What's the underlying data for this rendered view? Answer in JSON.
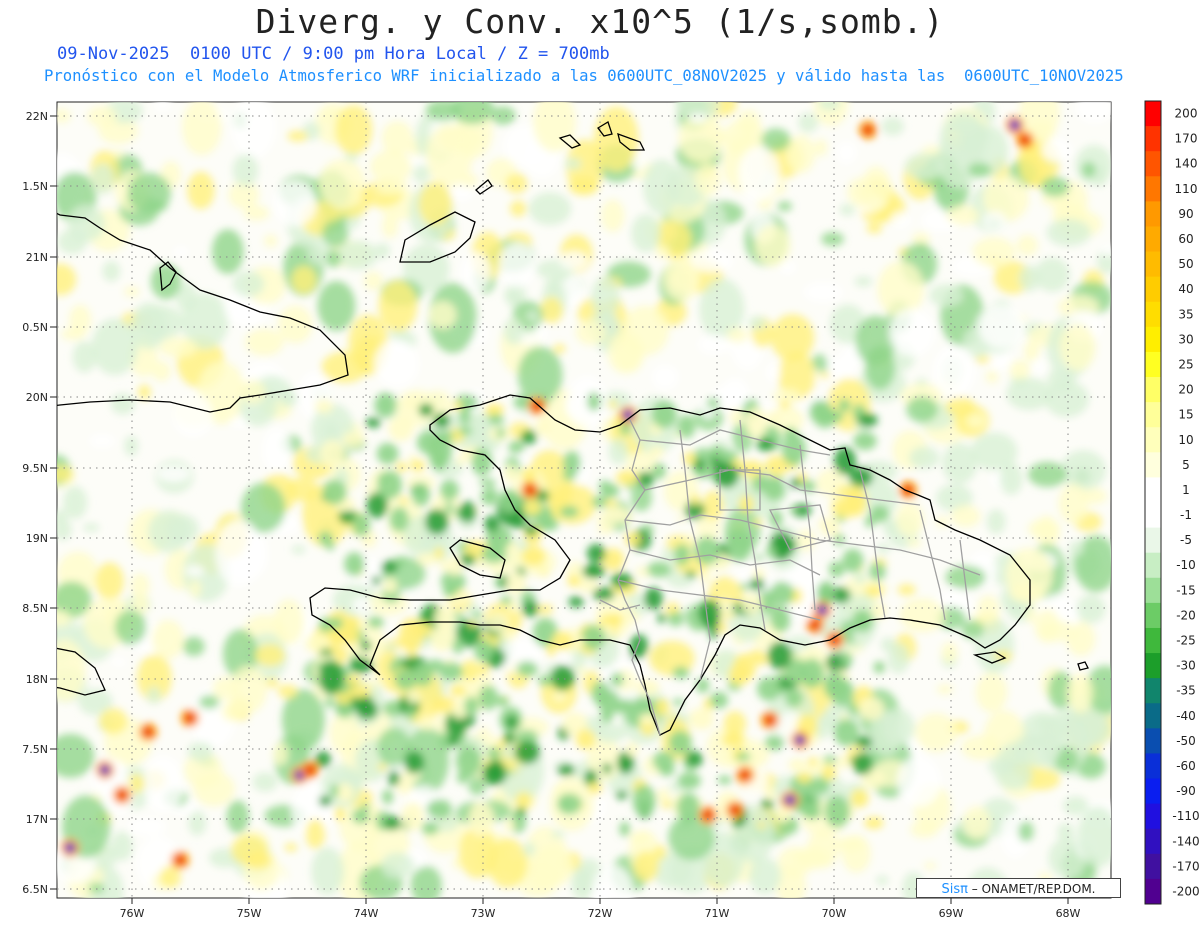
{
  "header": {
    "title": "Diverg. y Conv. x10^5 (1/s,somb.)",
    "subtitle_line1": "09-Nov-2025  0100 UTC / 9:00 pm Hora Local / Z = 700mb",
    "subtitle_line2": "Pronóstico con el Modelo Atmosferico WRF inicializado a las 0600UTC_08NOV2025 y válido hasta las  0600UTC_10NOV2025"
  },
  "map": {
    "lat_labels": [
      "22N",
      "1.5N",
      "21N",
      "0.5N",
      "20N",
      "9.5N",
      "19N",
      "8.5N",
      "18N",
      "7.5N",
      "17N",
      "6.5N"
    ],
    "lon_labels": [
      "76W",
      "75W",
      "74W",
      "73W",
      "72W",
      "71W",
      "70W",
      "69W",
      "68W"
    ]
  },
  "colorbar": {
    "labels": [
      "200",
      "170",
      "140",
      "110",
      "90",
      "60",
      "50",
      "40",
      "35",
      "30",
      "25",
      "20",
      "15",
      "10",
      "5",
      "1",
      "-1",
      "-5",
      "-10",
      "-15",
      "-20",
      "-25",
      "-30",
      "-35",
      "-40",
      "-50",
      "-60",
      "-90",
      "-110",
      "-140",
      "-170",
      "-200"
    ],
    "colors": [
      "#ff0000",
      "#ff3300",
      "#ff5500",
      "#ff7700",
      "#ff9900",
      "#ffaa00",
      "#ffbb00",
      "#ffcc00",
      "#ffdd00",
      "#ffee00",
      "#ffff22",
      "#ffff66",
      "#ffff99",
      "#ffffbb",
      "#ffffdd",
      "#ffffff",
      "#ffffff",
      "#eaf7e8",
      "#c8eec4",
      "#9ddf98",
      "#6ccc66",
      "#3fb83c",
      "#1c9e2a",
      "#11856c",
      "#0a6b88",
      "#0a4eb0",
      "#0a2fd8",
      "#0a1ef0",
      "#2010e0",
      "#3010c0",
      "#4010a0",
      "#500090"
    ]
  },
  "credit": {
    "logo": "Sisπ",
    "text": "– ONAMET/REP.DOM."
  },
  "palette": {
    "coast": "#000000",
    "provinces": "#a0a0a0",
    "grid": "#888888",
    "green_light": "#d8f0d4",
    "green_mid": "#8fd48a",
    "green_dark": "#2e9e3a",
    "yellow_light": "#fffcc8",
    "yellow_mid": "#fff07a",
    "orange": "#ff9a00",
    "red": "#e8201a",
    "blue": "#1530d0"
  }
}
